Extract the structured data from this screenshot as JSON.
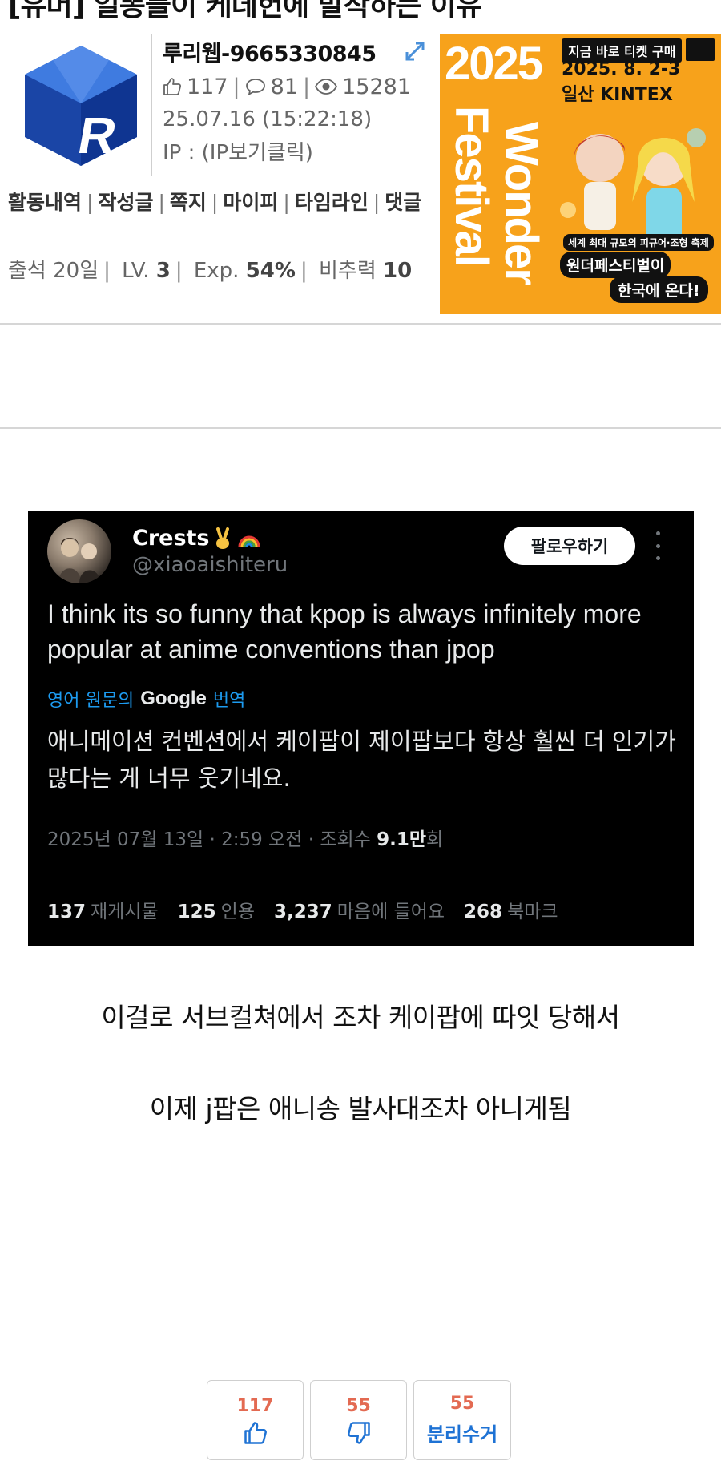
{
  "post": {
    "title": "[유머] 일뽕들이 케데헌에 발작하는 이유",
    "author": {
      "nickname": "루리웹-9665330845",
      "likes": "117",
      "comments": "81",
      "views": "15281",
      "date": "25.07.16 (15:22:18)",
      "ip_label": "IP : (IP보기클릭)"
    },
    "activity_links": [
      "활동내역",
      "작성글",
      "쪽지",
      "마이피",
      "타임라인",
      "댓글"
    ],
    "level": {
      "attendance": "출석 20일",
      "lv_label": "LV.",
      "lv_value": "3",
      "exp_label": "Exp.",
      "exp_value": "54%",
      "bichu_label": "비추력",
      "bichu_value": "10"
    }
  },
  "ad": {
    "year": "2025",
    "buy_now": "지금 바로 티켓 구매",
    "dates": "2025. 8. 2-3",
    "venue": "일산 KINTEX",
    "title_a": "Festival",
    "title_b": "Wonder",
    "tag1": "세계 최대 규모의 피규어·조형 축제",
    "tag2": "원더페스티벌이",
    "tag3": "한국에 온다!",
    "accent_color": "#f7a21b"
  },
  "tweet": {
    "name": "Crests",
    "handle": "@xiaoaishiteru",
    "follow_label": "팔로우하기",
    "text": "I think its so funny that kpop is always infinitely more popular at anime conventions than jpop",
    "translate_prefix": "영어 원문의",
    "translate_google": "Google",
    "translate_link": "번역",
    "translated": "애니메이션 컨벤션에서 케이팝이 제이팝보다 항상 훨씬 더 인기가 많다는 게 너무 웃기네요.",
    "time": "2025년 07월 13일 · 2:59 오전 · 조회수",
    "views_value": "9.1만",
    "views_suffix": "회",
    "retweets": "137",
    "retweets_label": "재게시물",
    "quotes": "125",
    "quotes_label": "인용",
    "likes": "3,237",
    "likes_label": "마음에 들어요",
    "bookmarks": "268",
    "bookmarks_label": "북마크"
  },
  "body": {
    "line1": "이걸로 서브컬쳐에서 조차 케이팝에 따잇 당해서",
    "line2": "이제 j팝은 애니송 발사대조차 아니게됨"
  },
  "votes": {
    "up_count": "117",
    "down_count": "55",
    "recycle_count": "55",
    "recycle_label": "분리수거"
  }
}
